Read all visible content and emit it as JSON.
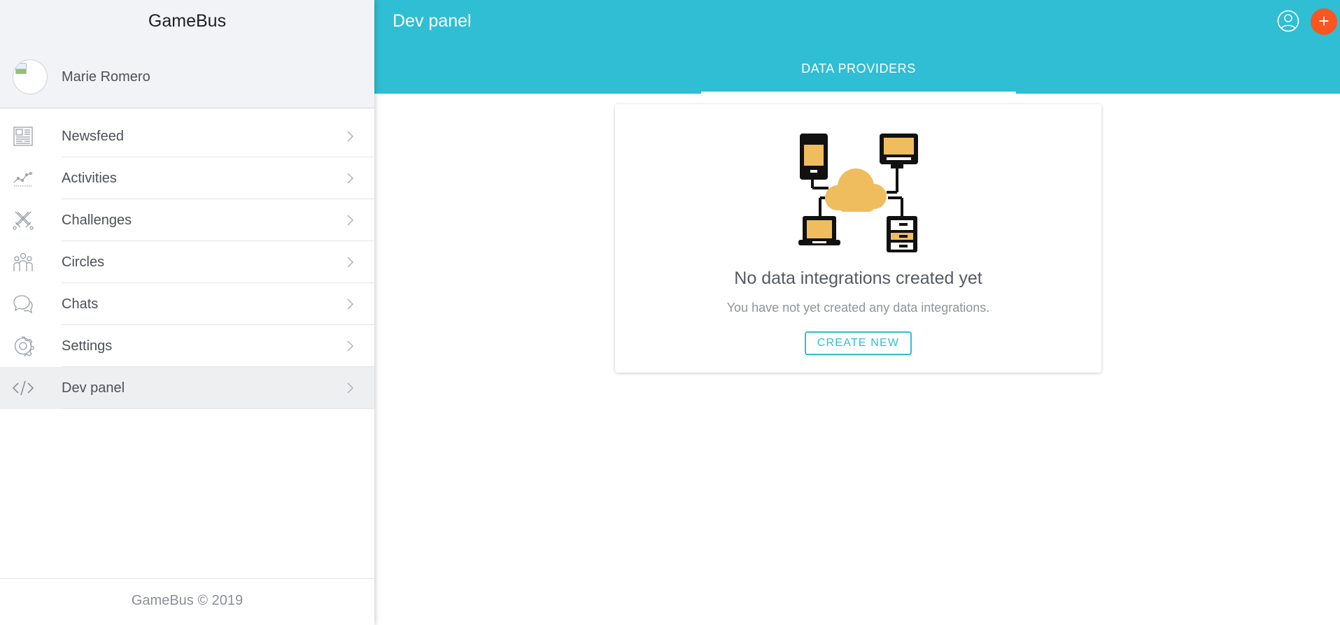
{
  "app": {
    "title": "GameBus",
    "footer": "GameBus © 2019"
  },
  "user": {
    "name": "Marie Romero"
  },
  "nav": {
    "items": [
      {
        "label": "Newsfeed",
        "icon": "newspaper-icon"
      },
      {
        "label": "Activities",
        "icon": "activity-chart-icon"
      },
      {
        "label": "Challenges",
        "icon": "crossed-swords-icon"
      },
      {
        "label": "Circles",
        "icon": "people-group-icon"
      },
      {
        "label": "Chats",
        "icon": "chat-bubbles-icon"
      },
      {
        "label": "Settings",
        "icon": "gear-icon"
      },
      {
        "label": "Dev panel",
        "icon": "code-icon",
        "active": true
      }
    ]
  },
  "header": {
    "title": "Dev panel",
    "tabs": [
      {
        "label": "DATA PROVIDERS",
        "active": true
      }
    ],
    "account_icon": "account-circle-icon",
    "add_icon": "plus-icon",
    "add_label": "+"
  },
  "empty_state": {
    "title": "No data integrations created yet",
    "subtitle": "You have not yet created any data integrations.",
    "button_label": "CREATE NEW",
    "illustration": "cloud-network-icon"
  },
  "colors": {
    "accent": "#2fbed4",
    "add_button": "#fb5520",
    "illustration_fill": "#f0bd5e",
    "sidebar_header_bg": "#f2f3f6"
  }
}
